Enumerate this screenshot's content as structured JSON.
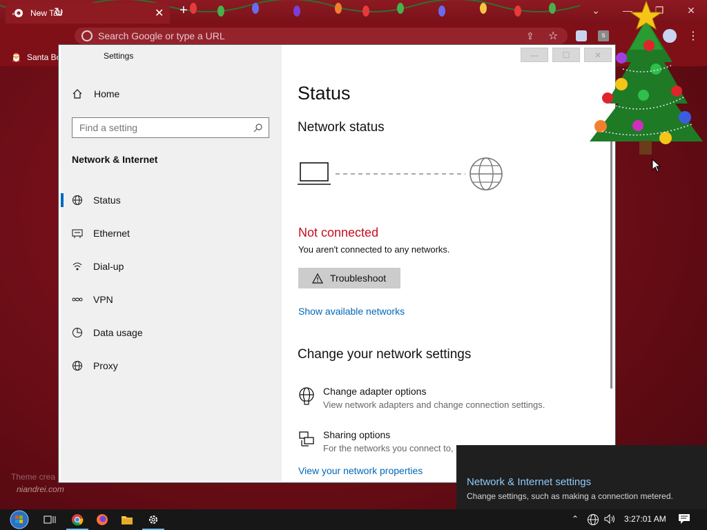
{
  "browser": {
    "tab_title": "New Tab",
    "tab_close": "✕",
    "new_tab": "+",
    "omnibox_placeholder": "Search Google or type a URL",
    "bookmark": "Santa Bo"
  },
  "settings": {
    "window_title": "Settings",
    "home_label": "Home",
    "search_placeholder": "Find a setting",
    "category": "Network & Internet",
    "nav": [
      {
        "label": "Status",
        "icon": "globe-icon",
        "selected": true
      },
      {
        "label": "Ethernet",
        "icon": "ethernet-icon"
      },
      {
        "label": "Dial-up",
        "icon": "dialup-icon"
      },
      {
        "label": "VPN",
        "icon": "vpn-icon"
      },
      {
        "label": "Data usage",
        "icon": "data-usage-icon"
      },
      {
        "label": "Proxy",
        "icon": "proxy-globe-icon"
      }
    ],
    "main": {
      "title": "Status",
      "network_status_heading": "Network status",
      "connection_state": "Not connected",
      "connection_detail": "You aren't connected to any networks.",
      "troubleshoot_label": "Troubleshoot",
      "show_networks_link": "Show available networks",
      "change_heading": "Change your network settings",
      "options": [
        {
          "title": "Change adapter options",
          "desc": "View network adapters and change connection settings.",
          "icon": "adapter-icon"
        },
        {
          "title": "Sharing options",
          "desc": "For the networks you connect to,",
          "icon": "sharing-icon"
        }
      ],
      "properties_link": "View your network properties"
    }
  },
  "toast": {
    "title": "Network & Internet settings",
    "desc": "Change settings, such as making a connection metered."
  },
  "watermark": {
    "line1": "Theme crea",
    "line2": "niandrei.com"
  },
  "taskbar": {
    "clock": "3:27:01 AM",
    "pinned": [
      "task-view-icon",
      "chrome-icon",
      "firefox-icon",
      "file-explorer-icon",
      "settings-icon"
    ]
  },
  "colors": {
    "accent": "#0067c0",
    "link": "#0067b8",
    "error": "#c50f1f",
    "browser_frame": "#7f1018",
    "toast_link": "#8ecbff"
  }
}
